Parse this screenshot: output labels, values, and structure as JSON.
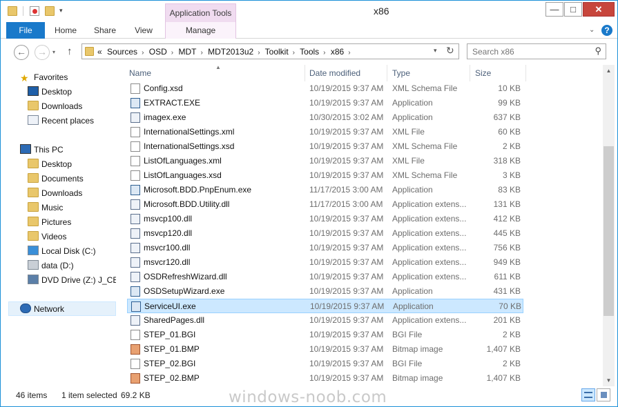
{
  "window": {
    "title": "x86",
    "context_tab_group": "Application Tools"
  },
  "ribbon": {
    "tabs": [
      "File",
      "Home",
      "Share",
      "View",
      "Manage"
    ]
  },
  "window_buttons": {
    "minimize": "—",
    "maximize": "□",
    "close": "✕",
    "help": "?",
    "collapse": "⌄"
  },
  "address": {
    "prefix": "«",
    "crumbs": [
      "Sources",
      "OSD",
      "MDT",
      "MDT2013u2",
      "Toolkit",
      "Tools",
      "x86"
    ],
    "refresh": "↻"
  },
  "search": {
    "placeholder": "Search x86"
  },
  "nav": {
    "favorites": {
      "label": "Favorites",
      "items": [
        "Desktop",
        "Downloads",
        "Recent places"
      ]
    },
    "this_pc": {
      "label": "This PC",
      "items": [
        "Desktop",
        "Documents",
        "Downloads",
        "Music",
        "Pictures",
        "Videos",
        "Local Disk (C:)",
        "data (D:)",
        "DVD Drive (Z:) J_CEN"
      ]
    },
    "network": {
      "label": "Network"
    }
  },
  "columns": {
    "name": "Name",
    "date": "Date modified",
    "type": "Type",
    "size": "Size"
  },
  "files": [
    {
      "name": "Config.xsd",
      "date": "10/19/2015 9:37 AM",
      "type": "XML Schema File",
      "size": "10 KB",
      "icon": "xsd"
    },
    {
      "name": "EXTRACT.EXE",
      "date": "10/19/2015 9:37 AM",
      "type": "Application",
      "size": "99 KB",
      "icon": "app"
    },
    {
      "name": "imagex.exe",
      "date": "10/30/2015 3:02 AM",
      "type": "Application",
      "size": "637 KB",
      "icon": "gear"
    },
    {
      "name": "InternationalSettings.xml",
      "date": "10/19/2015 9:37 AM",
      "type": "XML File",
      "size": "60 KB",
      "icon": "doc"
    },
    {
      "name": "InternationalSettings.xsd",
      "date": "10/19/2015 9:37 AM",
      "type": "XML Schema File",
      "size": "2 KB",
      "icon": "xsd"
    },
    {
      "name": "ListOfLanguages.xml",
      "date": "10/19/2015 9:37 AM",
      "type": "XML File",
      "size": "318 KB",
      "icon": "doc"
    },
    {
      "name": "ListOfLanguages.xsd",
      "date": "10/19/2015 9:37 AM",
      "type": "XML Schema File",
      "size": "3 KB",
      "icon": "xsd"
    },
    {
      "name": "Microsoft.BDD.PnpEnum.exe",
      "date": "11/17/2015 3:00 AM",
      "type": "Application",
      "size": "83 KB",
      "icon": "app"
    },
    {
      "name": "Microsoft.BDD.Utility.dll",
      "date": "11/17/2015 3:00 AM",
      "type": "Application extens...",
      "size": "131 KB",
      "icon": "gear"
    },
    {
      "name": "msvcp100.dll",
      "date": "10/19/2015 9:37 AM",
      "type": "Application extens...",
      "size": "412 KB",
      "icon": "gear"
    },
    {
      "name": "msvcp120.dll",
      "date": "10/19/2015 9:37 AM",
      "type": "Application extens...",
      "size": "445 KB",
      "icon": "gear"
    },
    {
      "name": "msvcr100.dll",
      "date": "10/19/2015 9:37 AM",
      "type": "Application extens...",
      "size": "756 KB",
      "icon": "gear"
    },
    {
      "name": "msvcr120.dll",
      "date": "10/19/2015 9:37 AM",
      "type": "Application extens...",
      "size": "949 KB",
      "icon": "gear"
    },
    {
      "name": "OSDRefreshWizard.dll",
      "date": "10/19/2015 9:37 AM",
      "type": "Application extens...",
      "size": "611 KB",
      "icon": "gear"
    },
    {
      "name": "OSDSetupWizard.exe",
      "date": "10/19/2015 9:37 AM",
      "type": "Application",
      "size": "431 KB",
      "icon": "app"
    },
    {
      "name": "ServiceUI.exe",
      "date": "10/19/2015 9:37 AM",
      "type": "Application",
      "size": "70 KB",
      "icon": "app",
      "selected": true
    },
    {
      "name": "SharedPages.dll",
      "date": "10/19/2015 9:37 AM",
      "type": "Application extens...",
      "size": "201 KB",
      "icon": "gear"
    },
    {
      "name": "STEP_01.BGI",
      "date": "10/19/2015 9:37 AM",
      "type": "BGI File",
      "size": "2 KB",
      "icon": "doc"
    },
    {
      "name": "STEP_01.BMP",
      "date": "10/19/2015 9:37 AM",
      "type": "Bitmap image",
      "size": "1,407 KB",
      "icon": "img"
    },
    {
      "name": "STEP_02.BGI",
      "date": "10/19/2015 9:37 AM",
      "type": "BGI File",
      "size": "2 KB",
      "icon": "doc"
    },
    {
      "name": "STEP_02.BMP",
      "date": "10/19/2015 9:37 AM",
      "type": "Bitmap image",
      "size": "1,407 KB",
      "icon": "img"
    }
  ],
  "status": {
    "count": "46 items",
    "selection": "1 item selected",
    "selection_size": "69.2 KB"
  },
  "watermark": "windows-noob.com"
}
